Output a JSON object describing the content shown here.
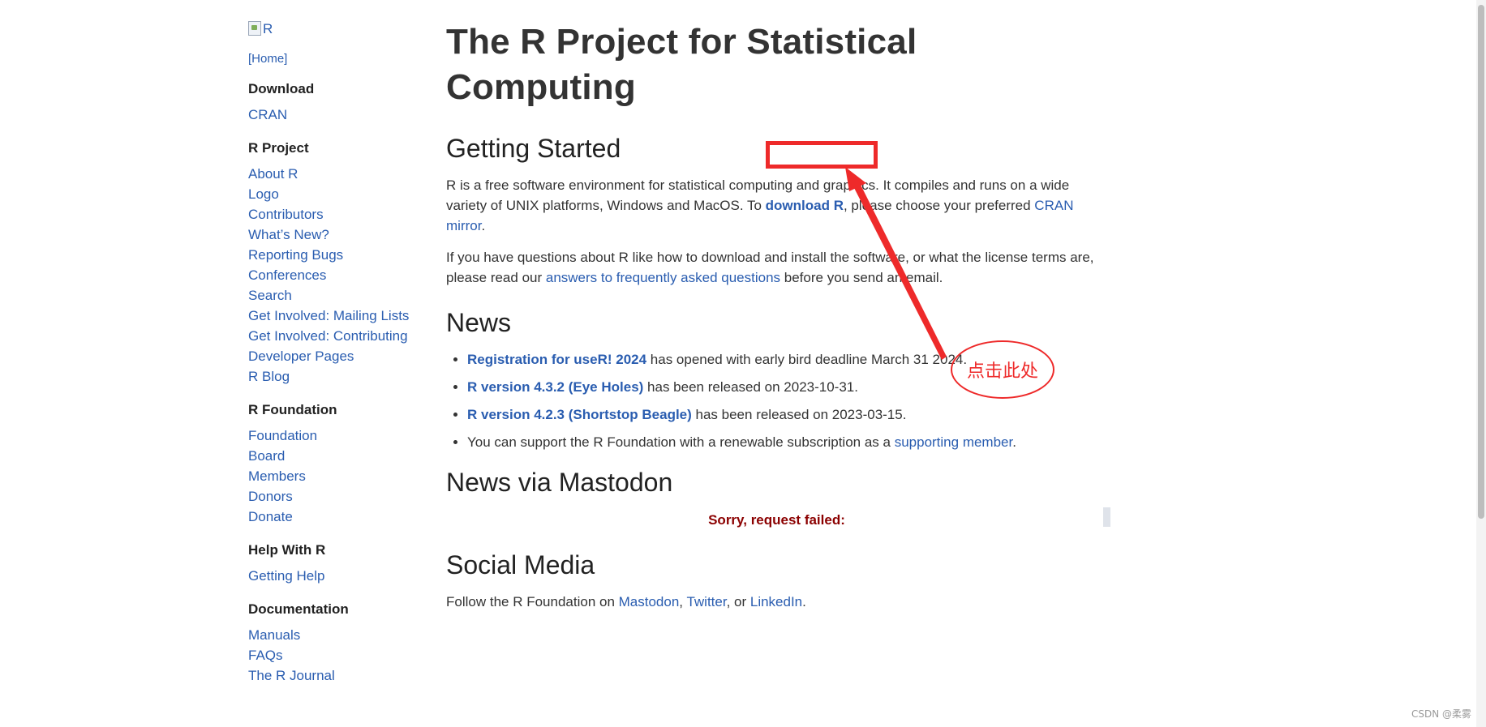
{
  "sidebar": {
    "logo_alt": "R",
    "home": "[Home]",
    "sections": [
      {
        "heading": "Download",
        "items": [
          "CRAN"
        ]
      },
      {
        "heading": "R Project",
        "items": [
          "About R",
          "Logo",
          "Contributors",
          "What’s New?",
          "Reporting Bugs",
          "Conferences",
          "Search",
          "Get Involved: Mailing Lists",
          "Get Involved: Contributing",
          "Developer Pages",
          "R Blog"
        ]
      },
      {
        "heading": "R Foundation",
        "items": [
          "Foundation",
          "Board",
          "Members",
          "Donors",
          "Donate"
        ]
      },
      {
        "heading": "Help With R",
        "items": [
          "Getting Help"
        ]
      },
      {
        "heading": "Documentation",
        "items": [
          "Manuals",
          "FAQs",
          "The R Journal"
        ]
      }
    ]
  },
  "main": {
    "title": "The R Project for Statistical Computing",
    "getting_started": {
      "heading": "Getting Started",
      "p1_a": "R is a free software environment for statistical computing and graphics. It compiles and runs on a wide variety of UNIX platforms, Windows and MacOS. To ",
      "p1_link": "download R",
      "p1_b": ", please choose your preferred ",
      "p1_link2": "CRAN mirror",
      "p1_c": ".",
      "p2_a": "If you have questions about R like how to download and install the software, or what the license terms are, please read our ",
      "p2_link": "answers to frequently asked questions",
      "p2_b": " before you send an email."
    },
    "news": {
      "heading": "News",
      "items": [
        {
          "link": "Registration for useR! 2024",
          "text": " has opened with early bird deadline March 31 2024."
        },
        {
          "link": "R version 4.3.2 (Eye Holes)",
          "text": " has been released on 2023-10-31."
        },
        {
          "link": "R version 4.2.3 (Shortstop Beagle)",
          "text": " has been released on 2023-03-15."
        }
      ],
      "support_a": "You can support the R Foundation with a renewable subscription as a ",
      "support_link": "supporting member",
      "support_b": "."
    },
    "mastodon": {
      "heading": "News via Mastodon",
      "error": "Sorry, request failed:"
    },
    "social": {
      "heading": "Social Media",
      "text_a": "Follow the R Foundation on ",
      "link1": "Mastodon",
      "sep1": ", ",
      "link2": "Twitter",
      "sep2": ", or ",
      "link3": "LinkedIn",
      "end": "."
    }
  },
  "annotation": {
    "label": "点击此处",
    "color": "#ee2a2a"
  },
  "watermark": "CSDN @柔雾"
}
